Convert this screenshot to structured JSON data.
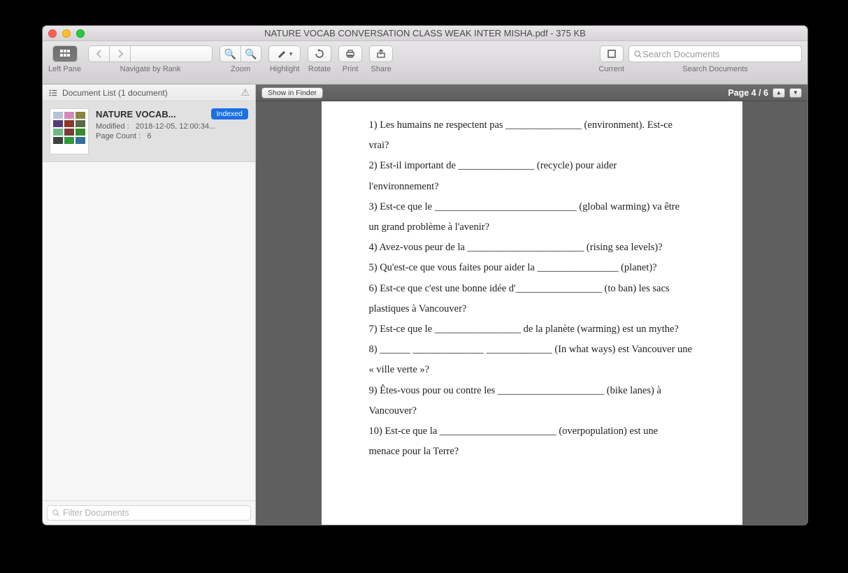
{
  "window": {
    "title": "NATURE VOCAB CONVERSATION CLASS WEAK INTER MISHA.pdf - 375 KB"
  },
  "toolbar": {
    "left_pane_label": "Left Pane",
    "navigate_label": "Navigate by Rank",
    "zoom_label": "Zoom",
    "highlight_label": "Highlight",
    "rotate_label": "Rotate",
    "print_label": "Print",
    "share_label": "Share",
    "current_label": "Current",
    "search_label": "Search Documents",
    "search_placeholder": "Search Documents"
  },
  "sidebar": {
    "header": "Document List (1 document)",
    "doc": {
      "name": "NATURE VOCAB...",
      "badge": "Indexed",
      "modified_label": "Modified :",
      "modified_value": "2018-12-05, 12:00:34...",
      "pagecount_label": "Page Count :",
      "pagecount_value": "6"
    },
    "filter_placeholder": "Filter Documents"
  },
  "viewer": {
    "show_in_finder": "Show in Finder",
    "page_label": "Page 4 / 6"
  },
  "document_lines": [
    "1) Les humains ne respectent pas _______________ (environment). Est-ce",
    "vrai?",
    "2) Est-il important de _______________ (recycle) pour aider",
    "l'environnement?",
    "3) Est-ce que le ____________________________ (global warming) va être",
    "un grand problème à l'avenir?",
    "4) Avez-vous peur de la _______________________ (rising sea levels)?",
    "5) Qu'est-ce que vous faites pour aider la ________________ (planet)?",
    "6) Est-ce que c'est une bonne idée d'_________________ (to ban) les sacs",
    "plastiques à Vancouver?",
    "7) Est-ce que le _________________ de la planète (warming) est un mythe?",
    "8) ______ ______________ _____________ (In what ways) est Vancouver une",
    "« ville verte »?",
    "9) Êtes-vous pour ou contre les _____________________ (bike lanes) à",
    "Vancouver?",
    "10) Est-ce que la _______________________ (overpopulation) est une",
    "menace pour la Terre?"
  ]
}
